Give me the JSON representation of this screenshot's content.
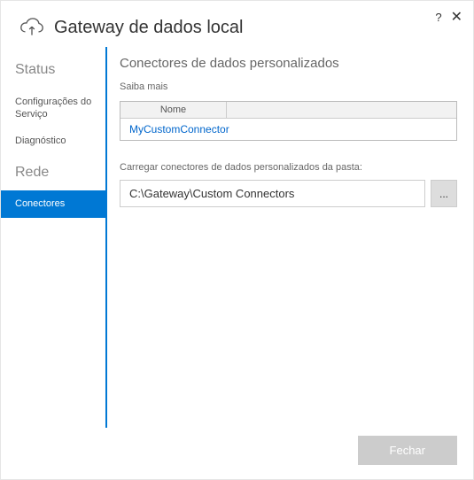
{
  "header": {
    "title": "Gateway de dados local",
    "help": "?",
    "close": "✕"
  },
  "sidebar": {
    "items": [
      {
        "label": "Status",
        "type": "section"
      },
      {
        "label": "Configurações do Serviço",
        "type": "item"
      },
      {
        "label": "Diagnóstico",
        "type": "item"
      },
      {
        "label": "Rede",
        "type": "section"
      },
      {
        "label": "Conectores",
        "type": "item-active"
      }
    ]
  },
  "main": {
    "section_title": "Conectores de dados personalizados",
    "learn_more": "Saiba mais",
    "table": {
      "col_name": "Nome",
      "rows": [
        "MyCustomConnector"
      ]
    },
    "folder_label": "Carregar conectores de dados personalizados da pasta:",
    "folder_path": "C:\\Gateway\\Custom Connectors",
    "browse": "..."
  },
  "footer": {
    "close_label": "Fechar"
  }
}
